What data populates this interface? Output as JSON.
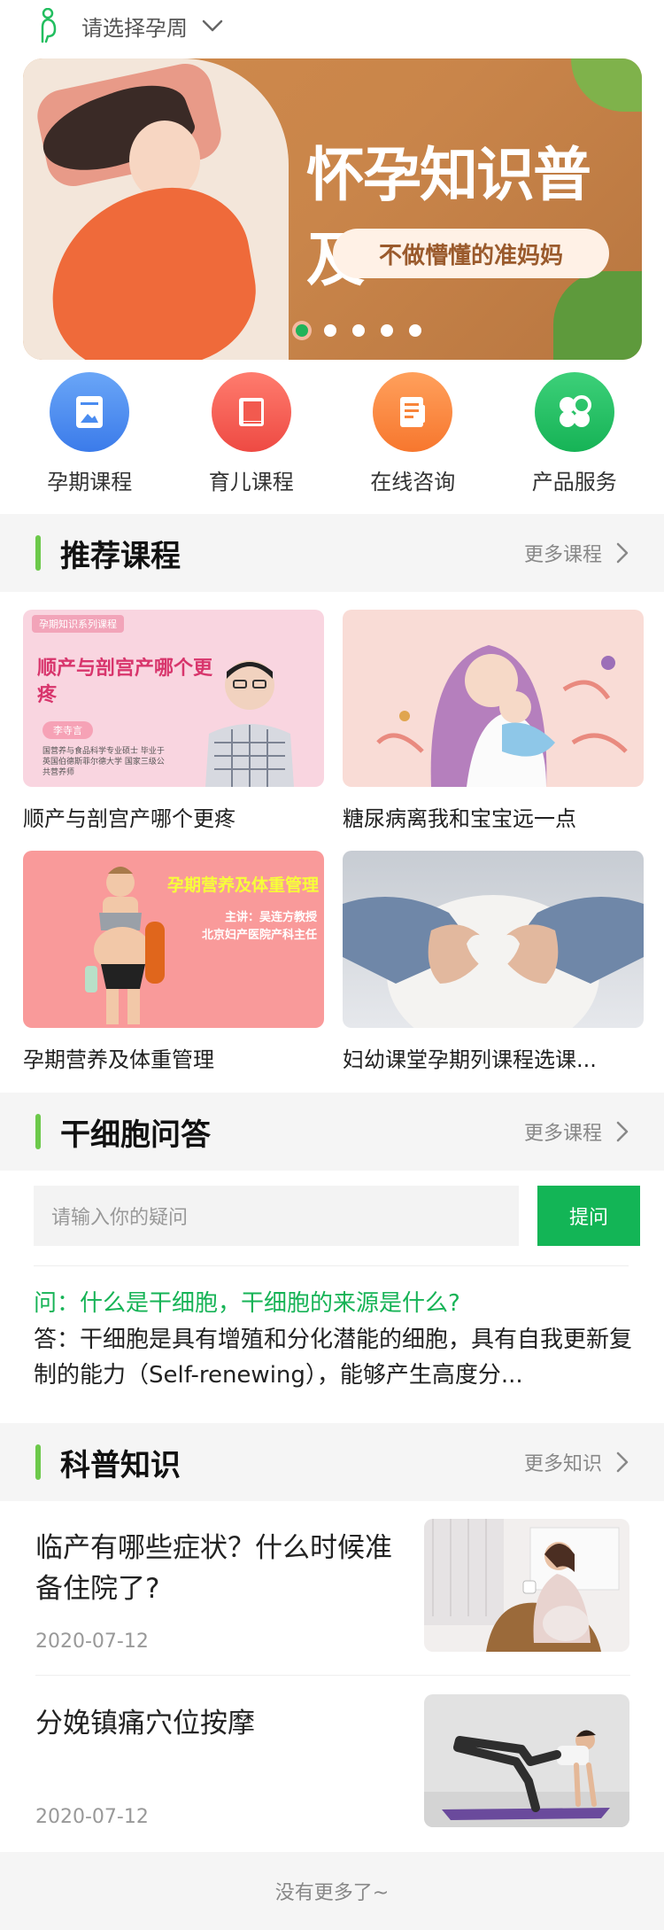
{
  "header": {
    "week_select_label": "请选择孕周"
  },
  "banner": {
    "title": "怀孕知识普及",
    "subtitle": "不做懵懂的准妈妈",
    "slide_count": 5,
    "active_slide": 1
  },
  "quick_nav": [
    {
      "label": "孕期课程",
      "icon": "document-icon",
      "color": "#4a8cf0"
    },
    {
      "label": "育儿课程",
      "icon": "book-icon",
      "color": "#f25a4f"
    },
    {
      "label": "在线咨询",
      "icon": "consult-list-icon",
      "color": "#f8843a"
    },
    {
      "label": "产品服务",
      "icon": "clover-icon",
      "color": "#22be5f"
    }
  ],
  "recommended": {
    "title": "推荐课程",
    "more": "更多课程",
    "courses": [
      {
        "title": "顺产与剖宫产哪个更疼",
        "thumb_tag": "孕期知识系列课程",
        "thumb_title": "顺产与剖宫产哪个更疼",
        "thumb_name": "李寺言",
        "thumb_desc": "国营养与食品科学专业硕士 毕业于英国伯德斯菲尔德大学 国家三级公共营养师"
      },
      {
        "title": "糖尿病离我和宝宝远一点"
      },
      {
        "title": "孕期营养及体重管理",
        "thumb_title": "孕期营养及体重管理",
        "thumb_sub1": "主讲：吴连方教授",
        "thumb_sub2": "北京妇产医院产科主任"
      },
      {
        "title": "妇幼课堂孕期列课程选课..."
      }
    ]
  },
  "qa": {
    "title": "干细胞问答",
    "more": "更多课程",
    "input_placeholder": "请输入你的疑问",
    "ask_button": "提问",
    "question": "问：什么是干细胞，干细胞的来源是什么?",
    "answer": "答：干细胞是具有增殖和分化潜能的细胞，具有自我更新复制的能力（Self-renewing），能够产生高度分..."
  },
  "science": {
    "title": "科普知识",
    "more": "更多知识",
    "articles": [
      {
        "title": "临产有哪些症状？什么时候准备住院了?",
        "date": "2020-07-12"
      },
      {
        "title": "分娩镇痛穴位按摩",
        "date": "2020-07-12"
      }
    ]
  },
  "footer": {
    "text": "没有更多了~"
  },
  "colors": {
    "accent_green": "#13b556",
    "section_bar": "#6cc94a"
  }
}
